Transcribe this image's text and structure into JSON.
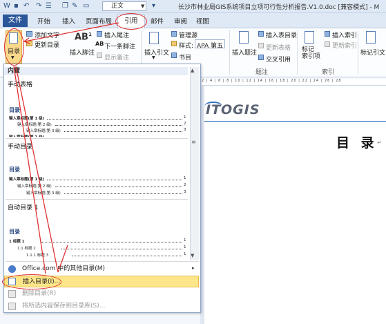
{
  "window": {
    "title": "长沙市林业局GIS系统项目立项可行性分析报告.V1.0.doc [兼容模式] - M",
    "style_box": "正文"
  },
  "tabs": [
    "文件",
    "开始",
    "插入",
    "页面布局",
    "引用",
    "邮件",
    "审阅",
    "视图"
  ],
  "ribbon": {
    "toc_button": "目录",
    "add_text": "添加文字",
    "update_toc": "更新目录",
    "insert_footnote": "插入脚注",
    "insert_endnote": "插入尾注",
    "next_footnote": "下一条脚注",
    "show_notes": "显示备注",
    "insert_citation": "插入引文",
    "manage_sources": "管理源",
    "style_label": "样式:",
    "style_value": "APA 第五",
    "bibliography": "书目",
    "insert_caption": "插入题注",
    "insert_table_of_figures": "插入表目录",
    "update_table": "更新表格",
    "cross_reference": "交叉引用",
    "mark_entry": "标记\n索引项",
    "insert_index": "插入索引",
    "update_index": "更新索引",
    "mark_citation": "标记引文",
    "group_caption": "题注",
    "group_index": "索引",
    "footnote_mark": "AB",
    "footnote_sup": "1"
  },
  "gallery": {
    "header": "内置",
    "items": [
      {
        "title": "手动表格",
        "preview_title": "目录",
        "entries": [
          {
            "text": "键入章标题(第 1 级)",
            "page": "1"
          },
          {
            "text": "键入章标题(第 2 级)",
            "page": "2"
          },
          {
            "text": "键入章标题(第 3 级)",
            "page": "3"
          },
          {
            "text": "键入章标题(第 1 级)",
            "page": "4"
          }
        ]
      },
      {
        "title": "手动目录",
        "preview_title": "目录",
        "entries": [
          {
            "text": "键入章标题(第 1 级)",
            "page": "1"
          },
          {
            "text": "键入章标题(第 2 级)",
            "page": "2"
          },
          {
            "text": "键入章标题(第 3 级)",
            "page": "3"
          }
        ]
      },
      {
        "title": "自动目录 1",
        "preview_title": "目录",
        "entries": [
          {
            "text": "1    标题 1",
            "page": "1"
          },
          {
            "text": "1.1      标题 2",
            "page": "1"
          },
          {
            "text": "1.1.1      标题 3",
            "page": "1"
          }
        ]
      }
    ],
    "menu": [
      {
        "label": "Office.com 中的其他目录(M)",
        "enabled": true
      },
      {
        "label": "插入目录(I)...",
        "enabled": true,
        "highlighted": true
      },
      {
        "label": "删除目录(R)",
        "enabled": false
      },
      {
        "label": "将所选内容保存到目录库(S)...",
        "enabled": false
      }
    ]
  },
  "document": {
    "logo": "ITOGIS",
    "heading": "目 录",
    "ruler": "2 | 4 | 6 | 8 | 10 | 12 | 14 | 16 | 18 | 20 | 22 | 24 | 26 | 28"
  },
  "colors": {
    "file_tab": "#2b579a",
    "highlight": "#fde68a",
    "annotation": "#e03030",
    "logo_blue": "#2e6fc3"
  }
}
